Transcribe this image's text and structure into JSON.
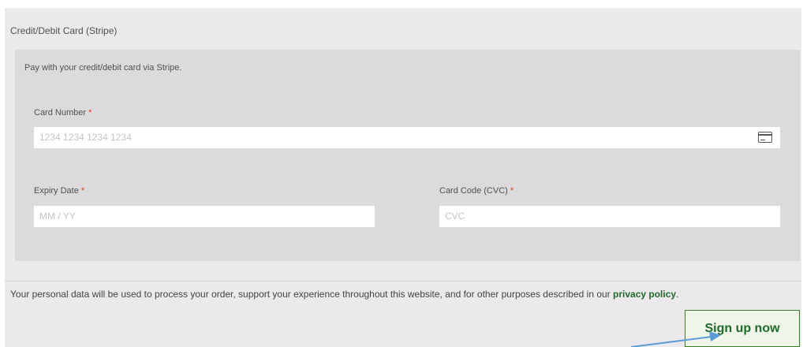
{
  "payment_method": {
    "label": "Credit/Debit Card (Stripe)",
    "description": "Pay with your credit/debit card via Stripe."
  },
  "card_number": {
    "label": "Card Number",
    "required_mark": "*",
    "placeholder": "1234 1234 1234 1234",
    "icon": "credit-card-icon"
  },
  "expiry": {
    "label": "Expiry Date",
    "required_mark": "*",
    "placeholder": "MM / YY"
  },
  "cvc": {
    "label": "Card Code (CVC)",
    "required_mark": "*",
    "placeholder": "CVC"
  },
  "privacy": {
    "text": "Your personal data will be used to process your order, support your experience throughout this website, and for other purposes described in our ",
    "link_text": "privacy policy",
    "suffix": "."
  },
  "signup_button": {
    "label": "Sign up now"
  },
  "colors": {
    "accent_green": "#1e6b2a",
    "required_red": "#e2401c",
    "annotation_arrow": "#5b9bd5"
  }
}
